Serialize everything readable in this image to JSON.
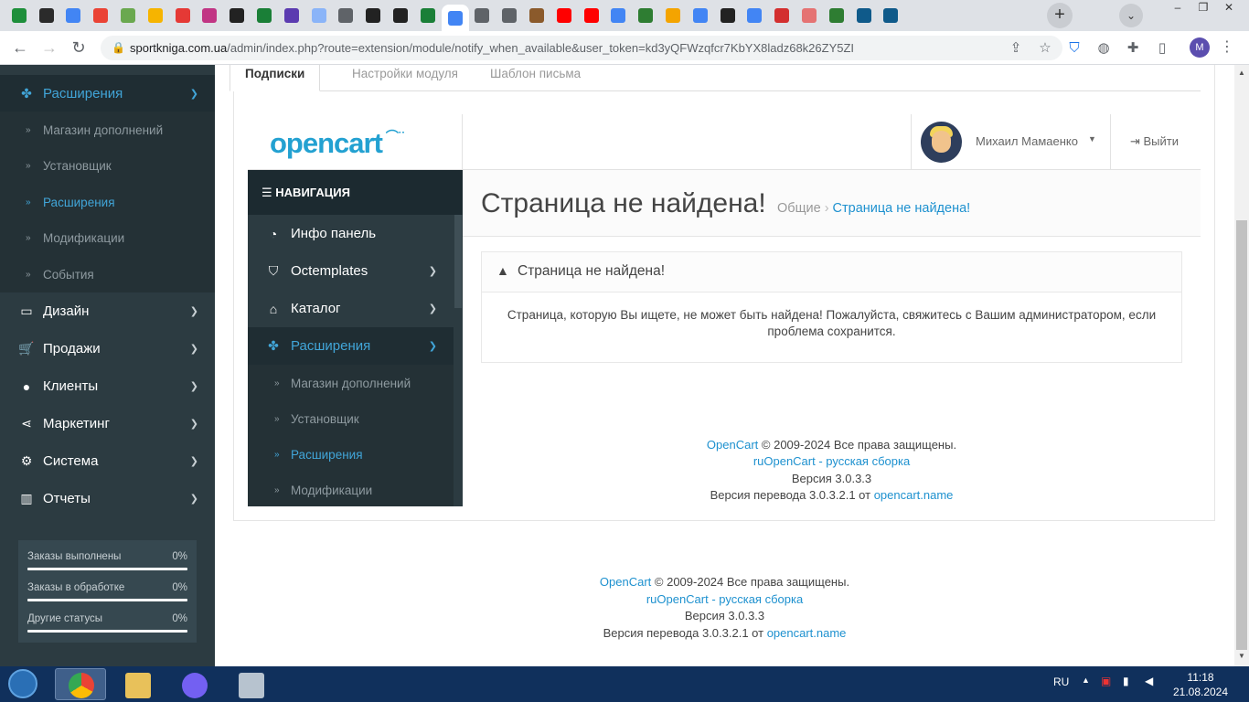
{
  "browser": {
    "tab_icon_colors": [
      "#1e8f3b",
      "#2b2b2b",
      "#4285f4",
      "#ea4335",
      "#6aa84f",
      "#f6b400",
      "#e53935",
      "#c13584",
      "#222222",
      "#1a7f37",
      "#5b3bb0",
      "#8ab4f8",
      "#5f6368",
      "#222222",
      "#222222",
      "#1a7f37",
      "#4285f4",
      "#5f6368",
      "#5f6368",
      "#8b5a2b",
      "#ff0000",
      "#ff0000",
      "#4285f4",
      "#2e7d32",
      "#f4a400",
      "#4285f4",
      "#222222",
      "#4285f4",
      "#d32f2f",
      "#e57373",
      "#2e7d32",
      "#0f5a8a",
      "#0f5a8a"
    ],
    "new_tab_label": "+",
    "url_domain": "sportkniga.com.ua",
    "url_path": "/admin/index.php?route=extension/module/notify_when_available&user_token=kd3yQFWzqfcr7KbYX8ladz68k26ZY5ZI",
    "profile_initial": "M"
  },
  "sidebar": {
    "items": [
      {
        "label": "Расширения",
        "icon": "puzzle-icon",
        "active": true
      },
      {
        "label": "Дизайн",
        "icon": "monitor-icon"
      },
      {
        "label": "Продажи",
        "icon": "cart-icon"
      },
      {
        "label": "Клиенты",
        "icon": "user-icon"
      },
      {
        "label": "Маркетинг",
        "icon": "share-icon"
      },
      {
        "label": "Система",
        "icon": "gear-icon"
      },
      {
        "label": "Отчеты",
        "icon": "bar-chart-icon"
      }
    ],
    "subitems": [
      {
        "label": "Магазин дополнений"
      },
      {
        "label": "Установщик"
      },
      {
        "label": "Расширения",
        "active": true
      },
      {
        "label": "Модификации"
      },
      {
        "label": "События"
      }
    ],
    "stats": [
      {
        "label": "Заказы выполнены",
        "value": "0%"
      },
      {
        "label": "Заказы в обработке",
        "value": "0%"
      },
      {
        "label": "Другие статусы",
        "value": "0%"
      }
    ]
  },
  "module_tabs": [
    "Подписки",
    "Настройки модуля",
    "Шаблон письма"
  ],
  "frame": {
    "logo_text": "opencart",
    "user_name": "Михаил Мамаенко",
    "logout_label": "Выйти",
    "nav_heading": "НАВИГАЦИЯ",
    "nav_items": [
      {
        "label": "Инфо панель",
        "icon": "dashboard-icon"
      },
      {
        "label": "Octemplates",
        "icon": "shield-icon"
      },
      {
        "label": "Каталог",
        "icon": "tag-icon"
      },
      {
        "label": "Расширения",
        "icon": "puzzle-icon",
        "active": true
      }
    ],
    "nav_subitems": [
      {
        "label": "Магазин дополнений"
      },
      {
        "label": "Установщик"
      },
      {
        "label": "Расширения",
        "active": true
      },
      {
        "label": "Модификации"
      }
    ],
    "page_title": "Страница не найдена!",
    "breadcrumb": [
      "Общие",
      "Страница не найдена!"
    ],
    "card_title": "Страница не найдена!",
    "card_body": "Страница, которую Вы ищете, не может быть найдена! Пожалуйста, свяжитесь с Вашим администратором, если проблема сохранится."
  },
  "footer": {
    "opencart_link": "OpenCart",
    "copyright": " © 2009-2024 Все права защищены.",
    "ru_link": "ruOpenCart - русская сборка",
    "version": "Версия 3.0.3.3",
    "translation_prefix": "Версия перевода 3.0.3.2.1 от ",
    "translation_link": "opencart.name"
  },
  "taskbar": {
    "lang": "RU",
    "time": "11:18",
    "date": "21.08.2024"
  }
}
